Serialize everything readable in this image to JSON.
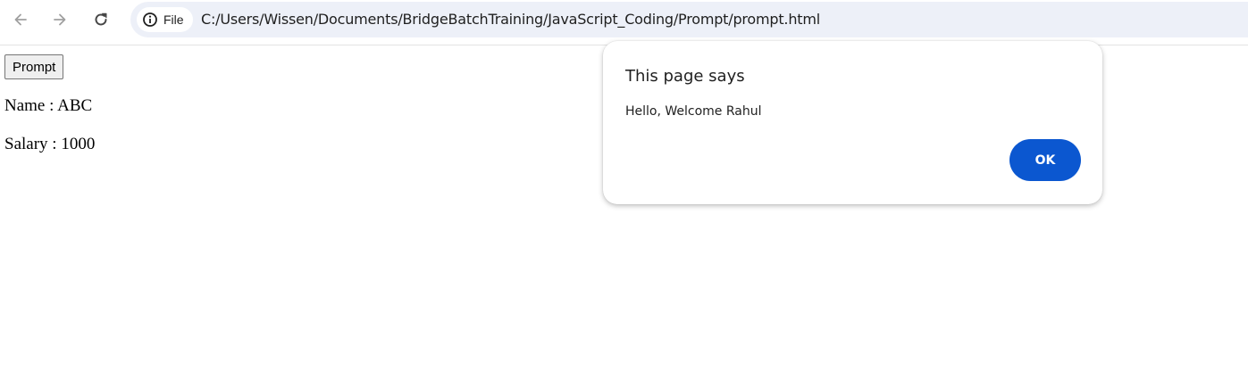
{
  "browser": {
    "back_icon": "arrow-left-icon",
    "forward_icon": "arrow-right-icon",
    "reload_icon": "reload-icon",
    "site_info_icon": "info-circle-icon",
    "site_chip_label": "File",
    "url": "C:/Users/Wissen/Documents/BridgeBatchTraining/JavaScript_Coding/Prompt/prompt.html"
  },
  "page": {
    "prompt_button_label": "Prompt",
    "name_line": "Name : ABC",
    "salary_line": "Salary : 1000"
  },
  "dialog": {
    "title": "This page says",
    "message": "Hello, Welcome Rahul",
    "ok_label": "OK",
    "ok_color": "#0b57d0"
  },
  "colors": {
    "omnibox_bg": "#edf0f8",
    "icon_active": "#474747",
    "icon_disabled": "#a0a0a0"
  }
}
